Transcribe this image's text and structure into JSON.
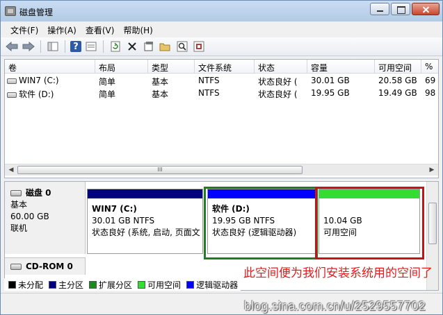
{
  "window": {
    "title": "磁盘管理"
  },
  "menu": [
    "文件(F)",
    "操作(A)",
    "查看(V)",
    "帮助(H)"
  ],
  "toolbar": {
    "icons": [
      "back-arrow-icon",
      "forward-arrow-icon",
      "console-tree-icon",
      "help-icon",
      "properties-icon",
      "refresh-icon",
      "delete-icon",
      "properties-sheet-icon",
      "open-folder-icon",
      "search-icon",
      "settings-icon"
    ]
  },
  "columns": [
    "卷",
    "布局",
    "类型",
    "文件系统",
    "状态",
    "容量",
    "可用空间",
    "%"
  ],
  "volumes": [
    {
      "name": "WIN7 (C:)",
      "layout": "简单",
      "type": "基本",
      "fs": "NTFS",
      "status": "状态良好 (",
      "capacity": "30.01 GB",
      "free": "20.58 GB",
      "pct": "69"
    },
    {
      "name": "软件 (D:)",
      "layout": "简单",
      "type": "基本",
      "fs": "NTFS",
      "status": "状态良好 (",
      "capacity": "19.95 GB",
      "free": "19.49 GB",
      "pct": "98"
    }
  ],
  "scroll_thumb_label": "III",
  "disk0": {
    "name": "磁盘 0",
    "type": "基本",
    "size": "60.00 GB",
    "state": "联机",
    "partitions": [
      {
        "title": "WIN7  (C:)",
        "size": "30.01 GB NTFS",
        "status": "状态良好 (系统, 启动, 页面文",
        "color": "#000080"
      },
      {
        "title": "软件  (D:)",
        "size": "19.95 GB NTFS",
        "status": "状态良好 (逻辑驱动器)",
        "color": "#0000ff"
      },
      {
        "title": "",
        "size": "10.04 GB",
        "status": "可用空间",
        "color": "#33dd33"
      }
    ]
  },
  "cdrom": {
    "name": "CD-ROM 0"
  },
  "legend": [
    {
      "label": "未分配",
      "color": "#000000"
    },
    {
      "label": "主分区",
      "color": "#000080"
    },
    {
      "label": "扩展分区",
      "color": "#1d8a1d"
    },
    {
      "label": "可用空间",
      "color": "#33dd33"
    },
    {
      "label": "逻辑驱动器",
      "color": "#0000ff"
    }
  ],
  "annotation": "此空间便为我们安装系统用的空间了",
  "watermark": "blog.sina.com.cn/u/2529557702"
}
